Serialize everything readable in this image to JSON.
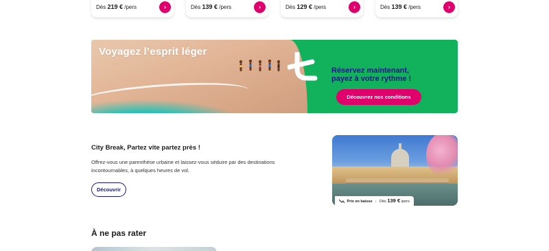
{
  "price_cards": [
    {
      "prefix": "Dès",
      "amount": "219 €",
      "suffix": "/pers",
      "arrow": "›"
    },
    {
      "prefix": "Dès",
      "amount": "139 €",
      "suffix": "/pers",
      "arrow": "›"
    },
    {
      "prefix": "Dès",
      "amount": "129 €",
      "suffix": "/pers",
      "arrow": "›"
    },
    {
      "prefix": "Dès",
      "amount": "139 €",
      "suffix": "/pers",
      "arrow": "›"
    }
  ],
  "banner": {
    "title": "Voyagez l’esprit léger",
    "headline_line1": "Réservez maintenant,",
    "headline_line2": "payez à votre rythme !",
    "cta_label": "Découvrez nos conditions",
    "colors": {
      "green": "#12b25d",
      "navy": "#16188a",
      "pink": "#e0006b"
    }
  },
  "city_break": {
    "title": "City Break, Partez vite partez près !",
    "description": "Offrez-vous une parenthèse urbaine et laissez-vous séduire par des destinations incontournables, à quelques heures de vol.",
    "button_label": "Découvrir",
    "badge": {
      "tag": "Prix en baisse",
      "prefix": "Dès",
      "amount": "139 €",
      "suffix": "/pers",
      "icon": "trend-down-icon"
    }
  },
  "section": {
    "title": "À ne pas rater"
  }
}
